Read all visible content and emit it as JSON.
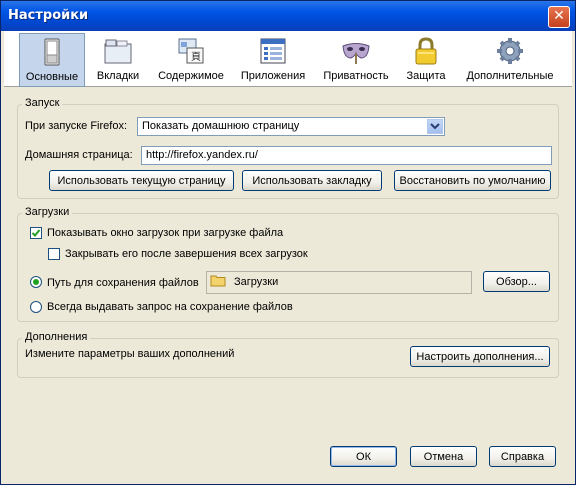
{
  "window": {
    "title": "Настройки",
    "close_glyph": "✕"
  },
  "toolbar": {
    "items": [
      {
        "label": "Основные",
        "icon": "switch-icon"
      },
      {
        "label": "Вкладки",
        "icon": "tabs-icon"
      },
      {
        "label": "Содержимое",
        "icon": "content-icon"
      },
      {
        "label": "Приложения",
        "icon": "applications-icon"
      },
      {
        "label": "Приватность",
        "icon": "mask-icon"
      },
      {
        "label": "Защита",
        "icon": "lock-icon"
      },
      {
        "label": "Дополнительные",
        "icon": "gear-icon"
      }
    ],
    "active": "Основные"
  },
  "startup": {
    "legend": "Запуск",
    "when_label": "При запуске Firefox:",
    "when_value": "Показать домашнюю страницу",
    "home_label": "Домашняя страница:",
    "home_value": "http://firefox.yandex.ru/",
    "use_current": "Использовать текущую страницу",
    "use_bookmark": "Использовать закладку",
    "restore_default": "Восстановить по умолчанию"
  },
  "downloads": {
    "legend": "Загрузки",
    "show_window": "Показывать окно загрузок при загрузке файла",
    "show_window_checked": true,
    "close_after": "Закрывать его после завершения всех загрузок",
    "close_after_checked": false,
    "save_path_label": "Путь для сохранения файлов",
    "save_path_value": "Загрузки",
    "browse": "Обзор...",
    "always_ask": "Всегда выдавать запрос на сохранение файлов",
    "selected_option": "save_path"
  },
  "addons": {
    "legend": "Дополнения",
    "description": "Измените параметры ваших дополнений",
    "manage": "Настроить дополнения..."
  },
  "footer": {
    "ok": "ОК",
    "cancel": "Отмена",
    "help": "Справка"
  },
  "colors": {
    "titlebar": "#0055e5",
    "dialog": "#ece9d8",
    "toolbar_active": "#c5d5ec"
  }
}
